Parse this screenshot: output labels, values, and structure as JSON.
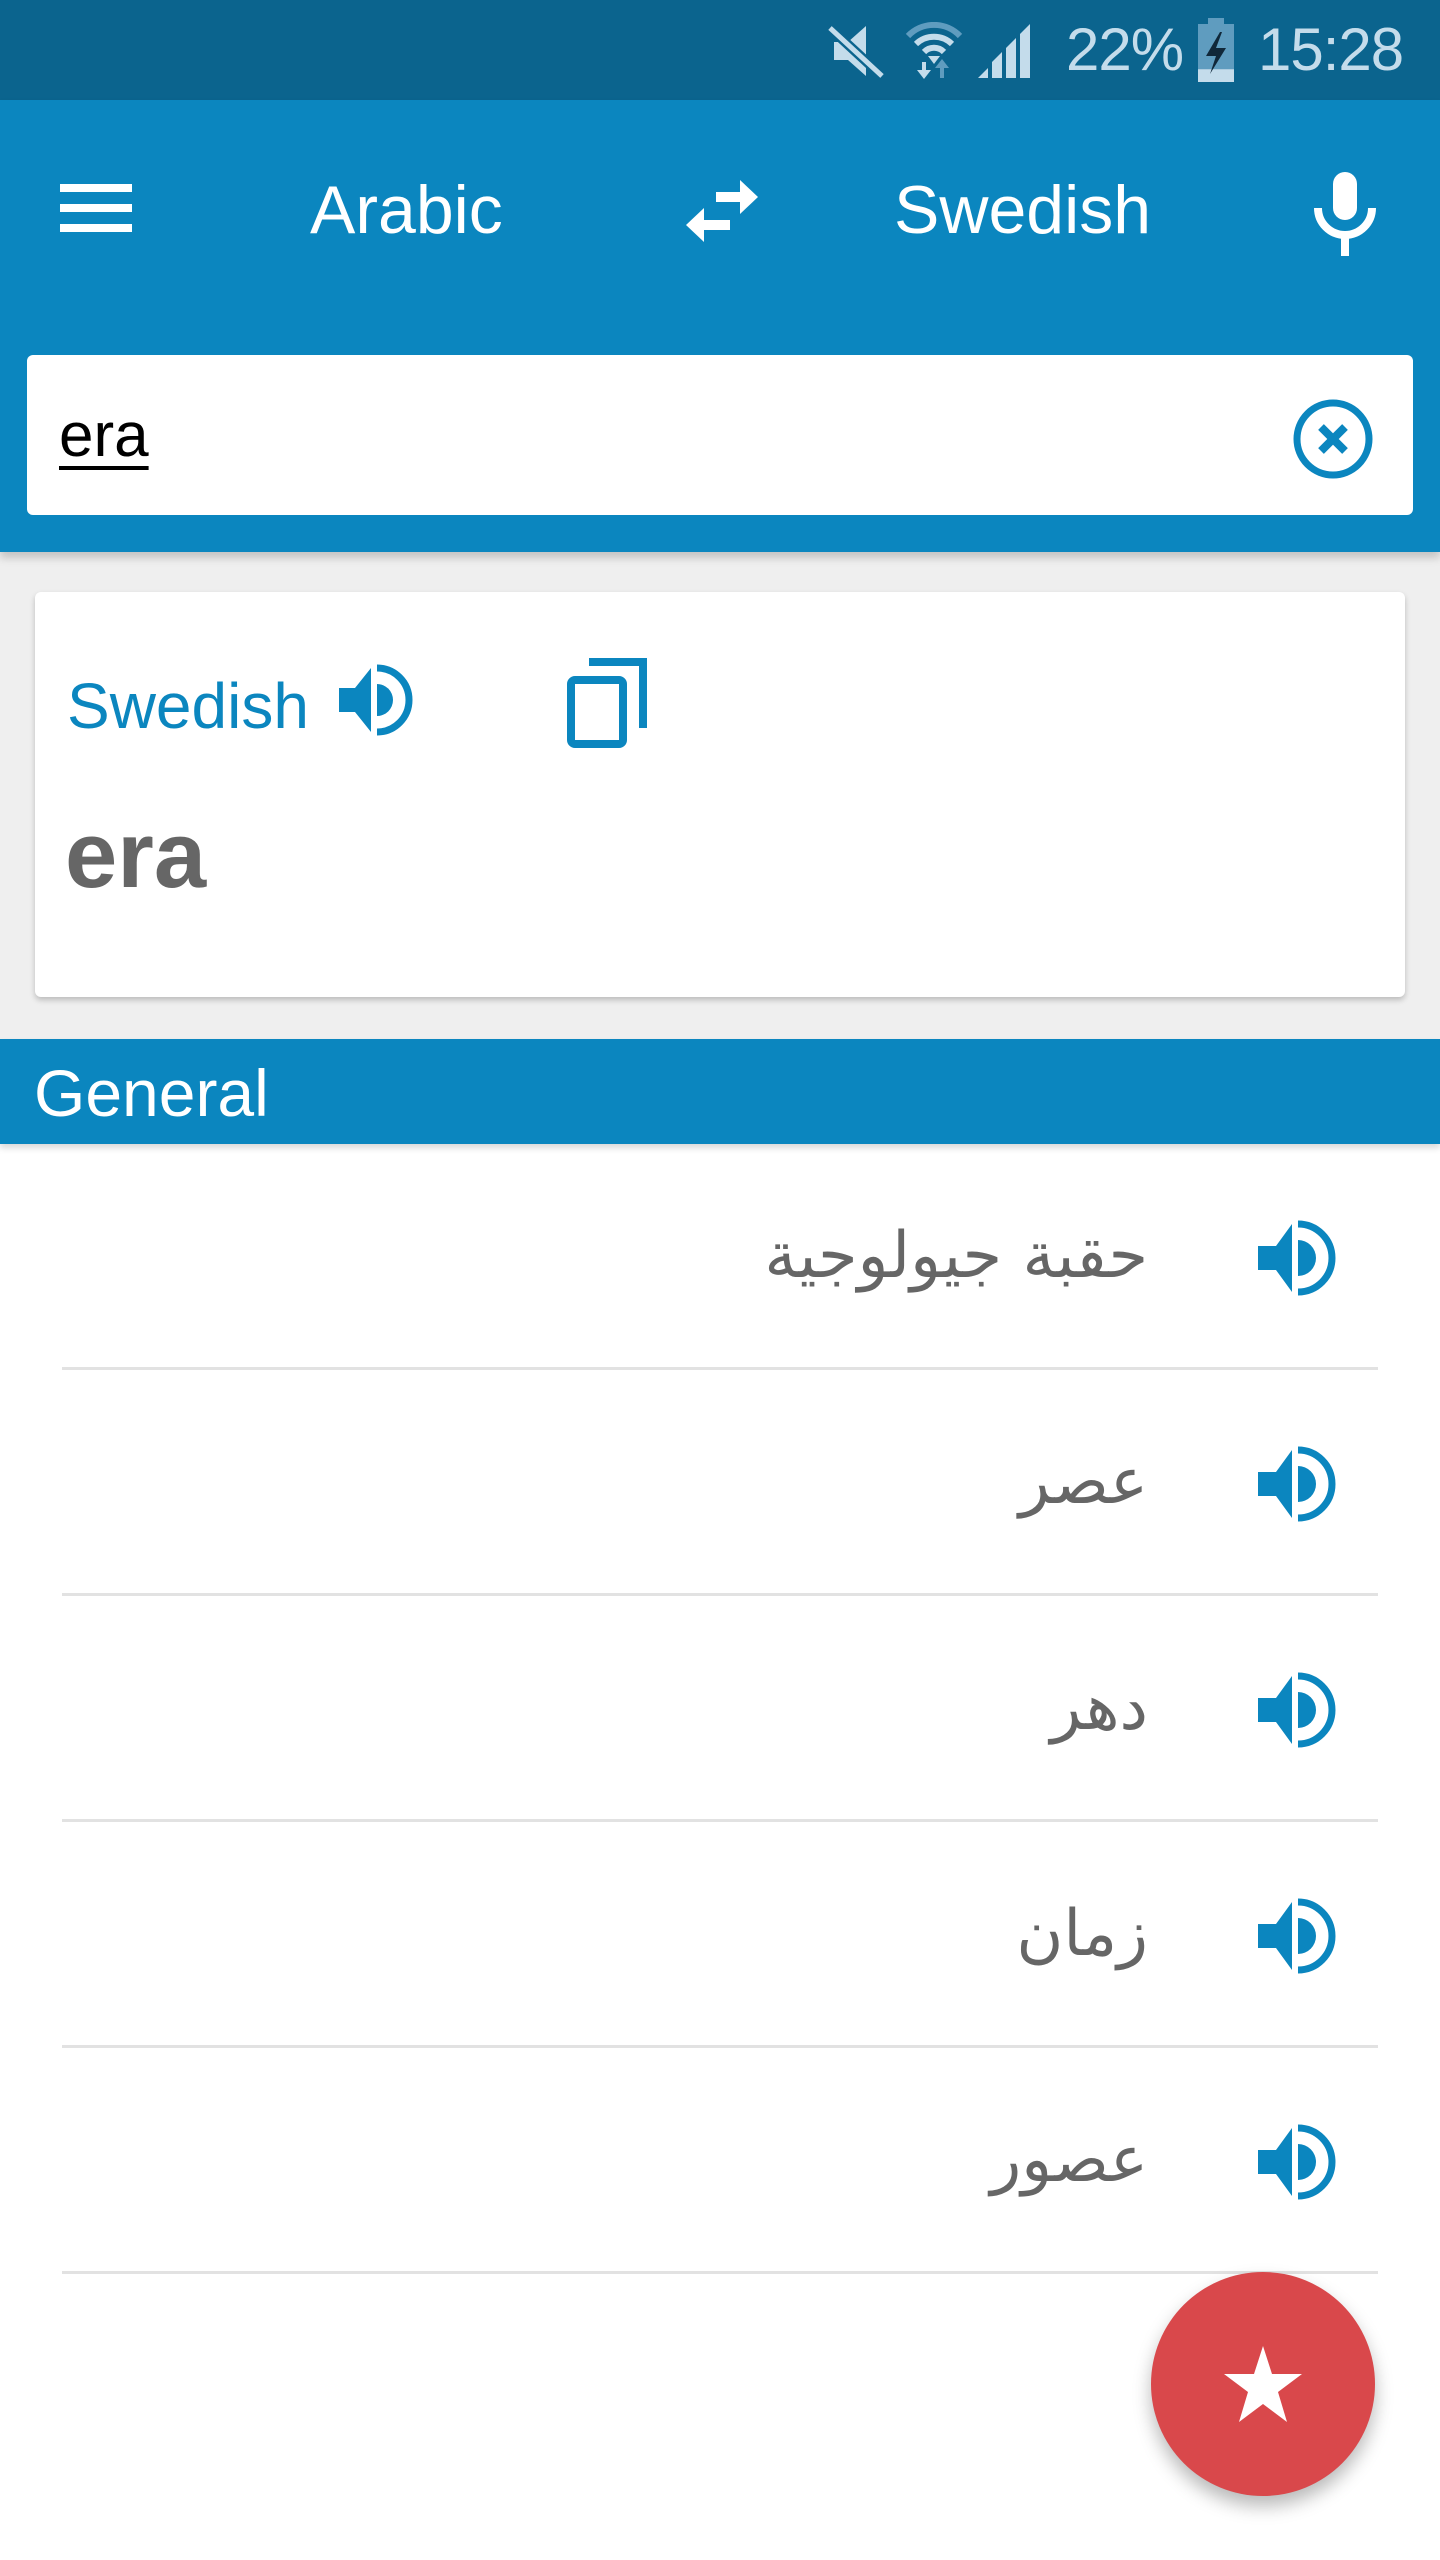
{
  "status_bar": {
    "icons": [
      "mute-icon",
      "wifi-icon",
      "cellular-signal-icon",
      "battery-charging-icon"
    ],
    "battery_percent": "22%",
    "battery_level": 0.22,
    "time": "15:28"
  },
  "app_bar": {
    "menu_icon": "hamburger-menu-icon",
    "source_language": "Arabic",
    "swap_icon": "swap-arrows-icon",
    "target_language": "Swedish",
    "mic_icon": "microphone-icon"
  },
  "search": {
    "value": "era",
    "placeholder": "",
    "clear_icon": "clear-circle-x-icon"
  },
  "result_card": {
    "language": "Swedish",
    "speak_icon": "speaker-icon",
    "copy_icon": "copy-icon",
    "word": "era"
  },
  "section": {
    "title": "General"
  },
  "translations": [
    {
      "term": "حقبة جيولوجية",
      "icon": "speaker-icon"
    },
    {
      "term": "عصر",
      "icon": "speaker-icon"
    },
    {
      "term": "دهر",
      "icon": "speaker-icon"
    },
    {
      "term": "زمان",
      "icon": "speaker-icon"
    },
    {
      "term": "عصور",
      "icon": "speaker-icon"
    }
  ],
  "fab": {
    "icon": "star-icon",
    "color": "#d9484b"
  },
  "colors": {
    "status_bar": "#0b648e",
    "primary": "#0b86bf",
    "accent": "#d9484b",
    "text_secondary": "#666666"
  }
}
